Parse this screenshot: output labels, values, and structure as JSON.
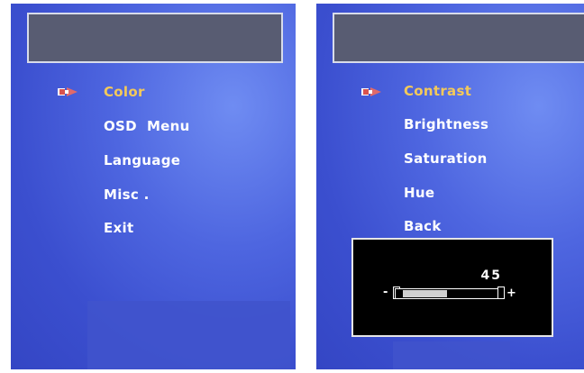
{
  "left_menu": {
    "items": [
      {
        "label": "Color",
        "selected": true
      },
      {
        "label": "OSD  Menu",
        "selected": false
      },
      {
        "label": "Language",
        "selected": false
      },
      {
        "label": "Misc .",
        "selected": false
      },
      {
        "label": "Exit",
        "selected": false
      }
    ]
  },
  "right_menu": {
    "items": [
      {
        "label": "Contrast",
        "selected": true
      },
      {
        "label": "Brightness",
        "selected": false
      },
      {
        "label": "Saturation",
        "selected": false
      },
      {
        "label": "Hue",
        "selected": false
      },
      {
        "label": "Back",
        "selected": false
      }
    ]
  },
  "adjustment": {
    "value": "45",
    "minus": "-",
    "plus": "+",
    "level_percent": 45
  },
  "colors": {
    "selected_text": "#f3c95a",
    "menu_text": "#ffffff",
    "cursor_icon": "#d9534f"
  },
  "icons": {
    "cursor": "arrow-cursor-icon"
  }
}
